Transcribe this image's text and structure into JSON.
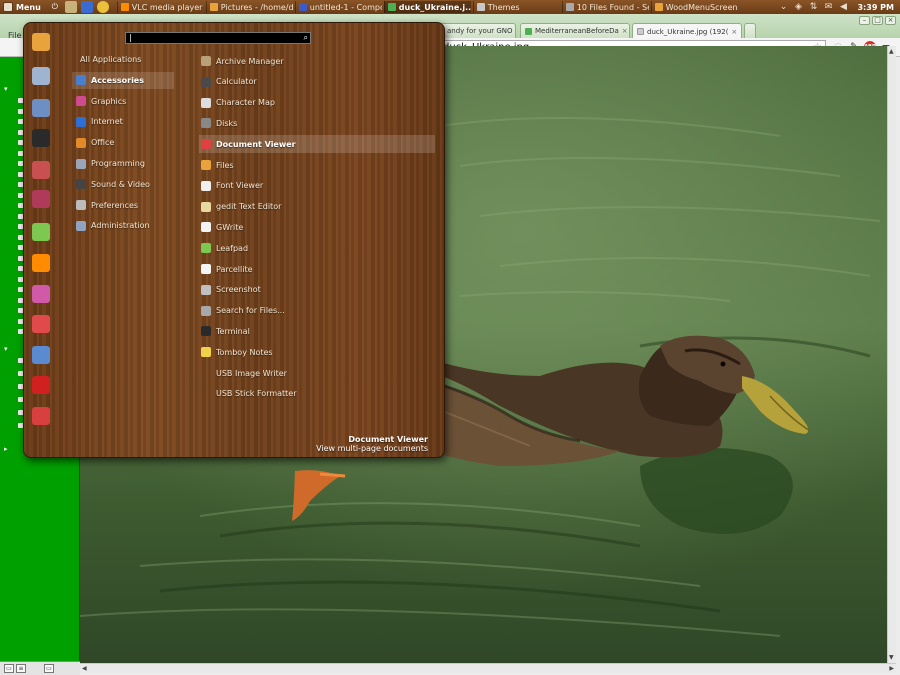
{
  "panel": {
    "menu_label": "Menu",
    "taskbar": [
      {
        "label": "VLC media player",
        "icon": "vlc-icon",
        "color": "#ff8c00",
        "active": false
      },
      {
        "label": "Pictures - /home/da...",
        "icon": "folder-icon",
        "color": "#e8a33c",
        "active": false
      },
      {
        "label": "untitled-1 - Compo...",
        "icon": "compositor-icon",
        "color": "#3c5ac8",
        "active": false
      },
      {
        "label": "duck_Ukraine.j...",
        "icon": "chrome-icon",
        "color": "#4caf50",
        "active": true
      },
      {
        "label": "Themes",
        "icon": "themes-icon",
        "color": "#c8c8c8",
        "active": false
      },
      {
        "label": "10 Files Found - Se...",
        "icon": "search-icon",
        "color": "#aaaaaa",
        "active": false
      },
      {
        "label": "WoodMenuScreens...",
        "icon": "image-icon",
        "color": "#e8a33c",
        "active": false
      }
    ],
    "clock": "3:39 PM"
  },
  "browser": {
    "menu_file": "File",
    "tabs": [
      {
        "label": "andy for your GNO",
        "active": false
      },
      {
        "label": "MediterraneanBeforeDa",
        "active": false
      },
      {
        "label": "duck_Ukraine.jpg (192(",
        "active": true
      }
    ],
    "address": "duck_Ukraine.jpg"
  },
  "menu": {
    "search_value": "|",
    "categories": [
      {
        "label": "All Applications",
        "icon": "none",
        "color": ""
      },
      {
        "label": "Accessories",
        "icon": "accessories-icon",
        "color": "#4a7fd0"
      },
      {
        "label": "Graphics",
        "icon": "graphics-icon",
        "color": "#d04a8e"
      },
      {
        "label": "Internet",
        "icon": "internet-icon",
        "color": "#2d6fd6"
      },
      {
        "label": "Office",
        "icon": "office-icon",
        "color": "#e08a2a"
      },
      {
        "label": "Programming",
        "icon": "programming-icon",
        "color": "#9aa6b8"
      },
      {
        "label": "Sound & Video",
        "icon": "sound-video-icon",
        "color": "#444444"
      },
      {
        "label": "Preferences",
        "icon": "preferences-icon",
        "color": "#bbbbbb"
      },
      {
        "label": "Administration",
        "icon": "administration-icon",
        "color": "#8fa4c0"
      }
    ],
    "apps": [
      {
        "label": "Archive Manager",
        "icon": "archive-icon",
        "color": "#b8a078"
      },
      {
        "label": "Calculator",
        "icon": "calculator-icon",
        "color": "#4a4a4a"
      },
      {
        "label": "Character Map",
        "icon": "character-map-icon",
        "color": "#dddddd"
      },
      {
        "label": "Disks",
        "icon": "disks-icon",
        "color": "#888888"
      },
      {
        "label": "Document Viewer",
        "icon": "document-viewer-icon",
        "color": "#e04040"
      },
      {
        "label": "Files",
        "icon": "files-icon",
        "color": "#e8a33c"
      },
      {
        "label": "Font Viewer",
        "icon": "font-viewer-icon",
        "color": "#f0f0f0"
      },
      {
        "label": "gedit Text Editor",
        "icon": "text-editor-icon",
        "color": "#e8d8a0"
      },
      {
        "label": "GWrite",
        "icon": "gwrite-icon",
        "color": "#f4f4f4"
      },
      {
        "label": "Leafpad",
        "icon": "leafpad-icon",
        "color": "#7cc850"
      },
      {
        "label": "Parcellite",
        "icon": "clipboard-icon",
        "color": "#f4f4f4"
      },
      {
        "label": "Screenshot",
        "icon": "screenshot-icon",
        "color": "#c0c0c0"
      },
      {
        "label": "Search for Files...",
        "icon": "search-files-icon",
        "color": "#a8a8a8"
      },
      {
        "label": "Terminal",
        "icon": "terminal-icon",
        "color": "#2a2a2a"
      },
      {
        "label": "Tomboy Notes",
        "icon": "notes-icon",
        "color": "#f2d14a"
      },
      {
        "label": "USB Image Writer",
        "icon": "none",
        "color": ""
      },
      {
        "label": "USB Stick Formatter",
        "icon": "none",
        "color": ""
      }
    ],
    "favorites": [
      {
        "icon": "home-folder-icon",
        "color": "#e8a33c"
      },
      {
        "icon": "search-icon",
        "color": "#9fb4cf"
      },
      {
        "icon": "settings-icon",
        "color": "#6d8fc4"
      },
      {
        "icon": "terminal-icon",
        "color": "#2a2a2a"
      },
      {
        "icon": "package-icon",
        "color": "#c85050"
      },
      {
        "icon": "gem-icon",
        "color": "#b03a5a"
      },
      {
        "icon": "leafpad-icon",
        "color": "#7cc850"
      },
      {
        "icon": "vlc-icon",
        "color": "#ff8c00"
      },
      {
        "icon": "paint-icon",
        "color": "#d05aa8"
      },
      {
        "icon": "disc-icon",
        "color": "#e04a4a"
      },
      {
        "icon": "upload-icon",
        "color": "#5a8ad0"
      },
      {
        "icon": "power-icon",
        "color": "#d02020"
      },
      {
        "icon": "logout-icon",
        "color": "#d84040"
      }
    ],
    "description": {
      "title": "Document Viewer",
      "text": "View multi-page documents"
    }
  }
}
